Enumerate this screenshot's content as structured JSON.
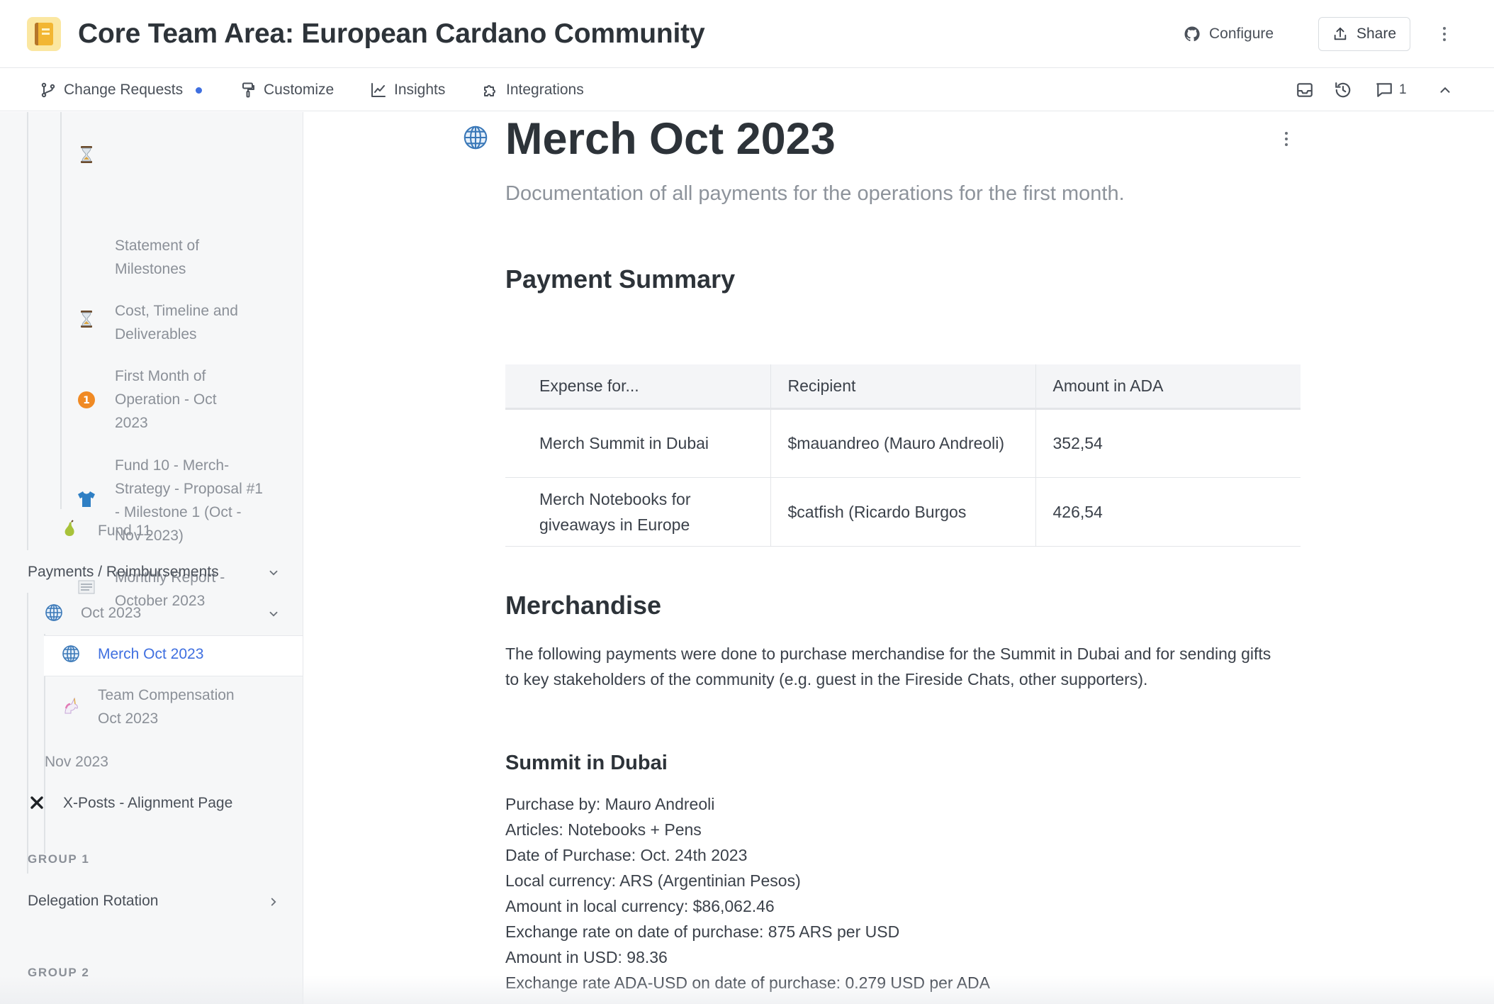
{
  "header": {
    "title": "Core Team Area: European Cardano Community",
    "configure_label": "Configure",
    "share_label": "Share"
  },
  "toolbar": {
    "change_requests": "Change Requests",
    "customize": "Customize",
    "insights": "Insights",
    "integrations": "Integrations",
    "comment_count": "1"
  },
  "sidebar": {
    "items": {
      "statement": "Statement of Milestones",
      "cost": "Cost, Timeline and Deliverables",
      "first_month": "First Month of Operation - Oct 2023",
      "fund10": "Fund 10 - Merch-Strategy - Proposal #1 - Milestone 1 (Oct - Nov 2023)",
      "monthly_report": "Monthly Report - October 2023",
      "fund11": "Fund 11",
      "payments": "Payments / Reimbursements",
      "oct2023": "Oct 2023",
      "merch_oct": "Merch Oct 2023",
      "team_comp": "Team Compensation Oct 2023",
      "nov2023": "Nov 2023",
      "xposts": "X-Posts - Alignment Page",
      "delegation": "Delegation Rotation"
    },
    "groups": {
      "group1": "GROUP 1",
      "group2": "GROUP 2"
    }
  },
  "page": {
    "title": "Merch Oct 2023",
    "description": "Documentation of all payments for the operations for the first month.",
    "payment_summary_heading": "Payment Summary",
    "table": {
      "headers": [
        "Expense for...",
        "Recipient",
        "Amount in ADA"
      ],
      "rows": [
        [
          "Merch Summit in Dubai",
          "$mauandreo (Mauro Andreoli)",
          "352,54"
        ],
        [
          "Merch Notebooks for giveaways in Europe",
          "$catfish (Ricardo Burgos",
          "426,54"
        ]
      ]
    },
    "merch_heading": "Merchandise",
    "merch_para": "The following payments were done to purchase merchandise for the Summit in Dubai and for sending gifts to key stakeholders of the community (e.g. guest in the Fireside Chats, other supporters).",
    "summit_heading": "Summit in Dubai",
    "details": [
      "Purchase by: Mauro Andreoli",
      "Articles: Notebooks + Pens",
      "Date of Purchase: Oct. 24th 2023",
      "Local currency: ARS (Argentinian Pesos)",
      "Amount in local currency: $86,062.46",
      "Exchange rate on date of purchase: 875 ARS per USD",
      "Amount in USD: 98.36",
      "Exchange rate ADA-USD on date of purchase: 0.279 USD per ADA"
    ]
  },
  "colors": {
    "accent": "#3f6fe0",
    "sidebar_bg": "#f6f7f8",
    "title_text": "#2d3339",
    "muted_text": "#8b9098"
  }
}
